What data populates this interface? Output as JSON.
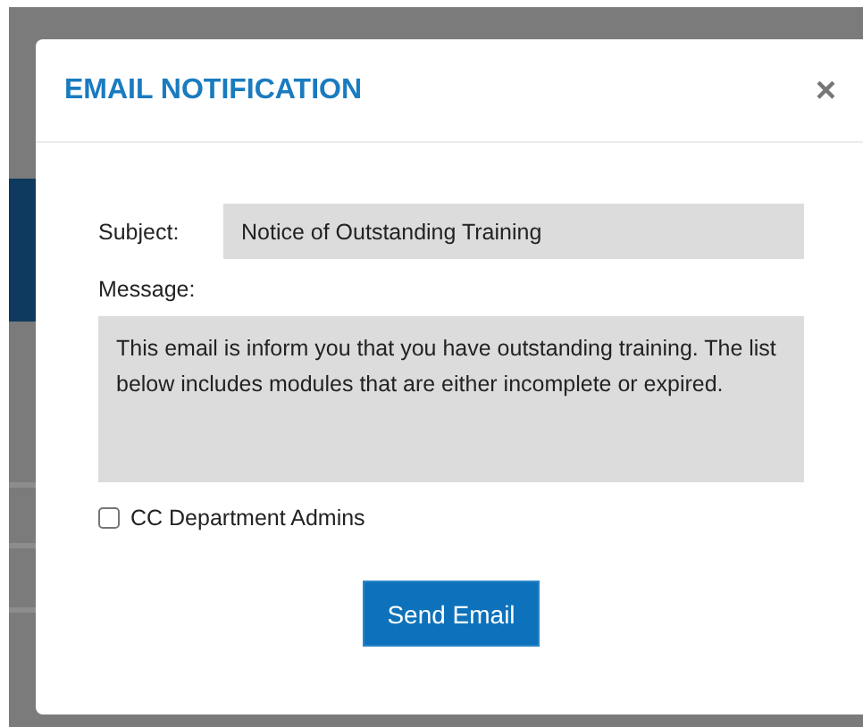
{
  "dialog": {
    "title": "EMAIL NOTIFICATION",
    "close": "×"
  },
  "subject": {
    "label": "Subject:",
    "value": "Notice of Outstanding Training"
  },
  "message": {
    "label": "Message:",
    "value": "This email is inform you that you have outstanding training. The list below includes modules that are either incomplete or expired."
  },
  "cc_admins": {
    "label": "CC Department Admins",
    "checked": false
  },
  "buttons": [
    "Send Email"
  ]
}
